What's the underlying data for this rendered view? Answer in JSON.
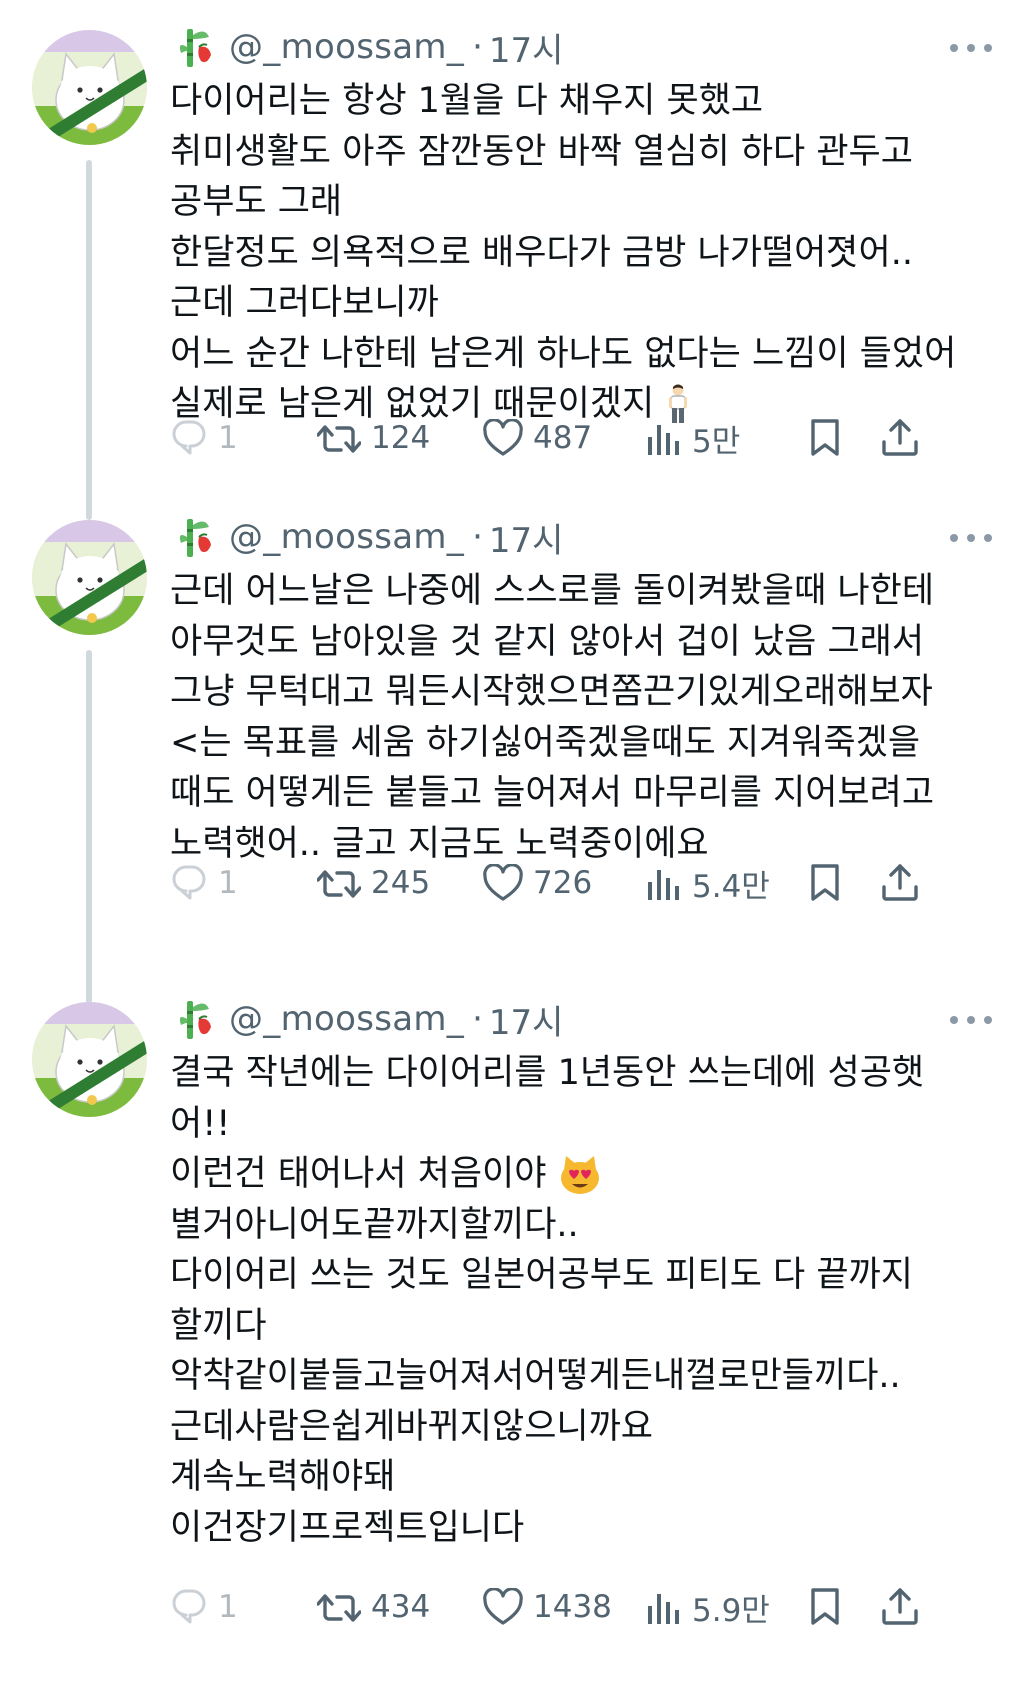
{
  "colors": {
    "text": "#0f1419",
    "muted": "#536471",
    "thread_line": "#cfd9de",
    "background": "#ffffff"
  },
  "posts": [
    {
      "handle": "@_moossam_",
      "dot": "·",
      "time": "17시",
      "lines": [
        "다이어리는 항상 1월을 다 채우지 못했고",
        "취미생활도 아주 잠깐동안 바짝 열심히 하다 관두고",
        "공부도 그래",
        "한달정도 의욕적으로 배우다가 금방 나가떨어졋어..",
        "근데 그러다보니까",
        "어느 순간 나한테 남은게 하나도 없다는 느낌이 들었어",
        "실제로 남은게 없었기 때문이겠지"
      ],
      "trailing_emoji": "standing-person-emoji",
      "replies": "1",
      "reposts": "124",
      "likes": "487",
      "views": "5만"
    },
    {
      "handle": "@_moossam_",
      "dot": "·",
      "time": "17시",
      "lines": [
        "근데 어느날은 나중에 스스로를 돌이켜봤을때 나한테",
        "아무것도 남아있을 것 같지 않아서 겁이 났음 그래서",
        "그냥 무턱대고 뭐든시작했으면쫌끈기있게오래해보자",
        "<는 목표를 세움 하기싫어죽겠을때도 지겨워죽겠을",
        "때도 어떻게든 붙들고 늘어져서 마무리를 지어보려고",
        "노력햇어.. 글고 지금도 노력중이에요"
      ],
      "replies": "1",
      "reposts": "245",
      "likes": "726",
      "views": "5.4만"
    },
    {
      "handle": "@_moossam_",
      "dot": "·",
      "time": "17시",
      "lines": [
        "결국 작년에는 다이어리를 1년동안 쓰는데에 성공햇",
        "어!!",
        "이런건 태어나서 처음이야",
        "별거아니어도끝까지할끼다..",
        "다이어리 쓰는 것도 일본어공부도 피티도 다 끝까지",
        "할끼다",
        "악착같이붙들고늘어져서어떻게든내껄로만들끼다..",
        "근데사람은쉽게바뀌지않으니까요",
        "계속노력해야돼",
        "이건장기프로젝트입니다"
      ],
      "emoji_after_line_3": "heart-eyes-cat-emoji",
      "replies": "1",
      "reposts": "434",
      "likes": "1438",
      "views": "5.9만"
    }
  ]
}
